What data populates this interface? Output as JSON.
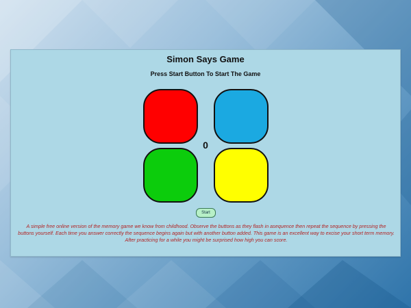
{
  "page": {
    "title": "Simon Says Game",
    "instruction": "Press Start Button To Start The Game",
    "score": "0",
    "start_label": "Start",
    "description": "A simple free online version of the memory game we know from childhood. Observe the buttons as they flash in asequence then repeat the sequence by pressing the buttons yourself. Each time you answer correctly the sequence begins again but with another button added. This game is an excellent way to excise your short term memory. After practicing for a while you might be surprised how high you can score."
  },
  "buttons": [
    {
      "name": "red",
      "color": "#ff0000"
    },
    {
      "name": "blue",
      "color": "#1ba9e1"
    },
    {
      "name": "green",
      "color": "#0ccc0c"
    },
    {
      "name": "yellow",
      "color": "#ffff00"
    }
  ],
  "colors": {
    "panel_background": "#add8e6",
    "description_text": "#b22222",
    "start_button": "#b7f0c7"
  }
}
